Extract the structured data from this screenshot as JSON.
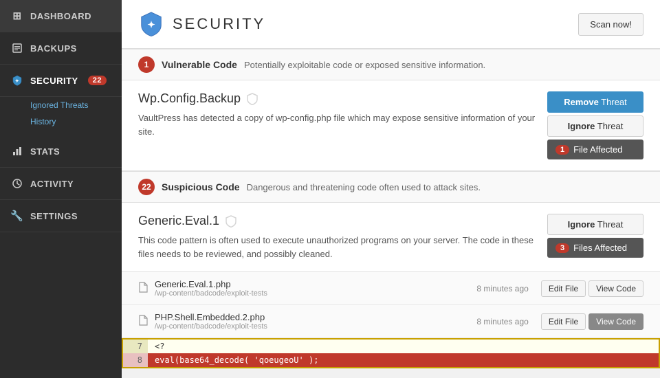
{
  "sidebar": {
    "items": [
      {
        "id": "dashboard",
        "label": "Dashboard",
        "icon": "⊞",
        "badge": null,
        "active": false
      },
      {
        "id": "backups",
        "label": "Backups",
        "icon": "🗄",
        "badge": null,
        "active": false
      },
      {
        "id": "security",
        "label": "Security",
        "icon": "✦",
        "badge": "22",
        "active": true
      },
      {
        "id": "stats",
        "label": "Stats",
        "icon": "📊",
        "badge": null,
        "active": false
      },
      {
        "id": "activity",
        "label": "Activity",
        "icon": "🔔",
        "badge": null,
        "active": false
      },
      {
        "id": "settings",
        "label": "Settings",
        "icon": "🔧",
        "badge": null,
        "active": false
      }
    ],
    "security_sub": [
      {
        "id": "ignored-threats",
        "label": "Ignored Threats"
      },
      {
        "id": "history",
        "label": "History"
      }
    ]
  },
  "header": {
    "title": "SECURITY",
    "scan_button": "Scan now!"
  },
  "threat_sections": [
    {
      "id": "vulnerable-code",
      "count": "1",
      "type": "Vulnerable Code",
      "description": "Potentially exploitable code or exposed sensitive information.",
      "threats": [
        {
          "id": "wp-config-backup",
          "name": "Wp.Config.Backup",
          "description": "VaultPress has detected a copy of wp-config.php file which may expose sensitive information of your site.",
          "actions": {
            "primary": {
              "strong": "Remove",
              "rest": " Threat"
            },
            "secondary": {
              "strong": "Ignore",
              "rest": " Threat"
            },
            "files": {
              "count": "1",
              "label": "File Affected"
            }
          }
        }
      ]
    },
    {
      "id": "suspicious-code",
      "count": "22",
      "type": "Suspicious Code",
      "description": "Dangerous and threatening code often used to attack sites.",
      "threats": [
        {
          "id": "generic-eval-1",
          "name": "Generic.Eval.1",
          "description": "This code pattern is often used to execute unauthorized programs on your server. The code in these files needs to be reviewed, and possibly cleaned.",
          "actions": {
            "secondary": {
              "strong": "Ignore",
              "rest": " Threat"
            },
            "files": {
              "count": "3",
              "label": "Files Affected"
            }
          },
          "files": [
            {
              "name": "Generic.Eval.1.php",
              "path": "/wp-content/badcode/exploit-tests",
              "time": "8 minutes ago",
              "edit_label": "Edit File",
              "view_label": "View Code"
            },
            {
              "name": "PHP.Shell.Embedded.2.php",
              "path": "/wp-content/badcode/exploit-tests",
              "time": "8 minutes ago",
              "edit_label": "Edit File",
              "view_label": "View Code",
              "view_active": true
            }
          ],
          "code_preview": {
            "lines": [
              {
                "num": "7",
                "content": "<?",
                "highlight": false
              },
              {
                "num": "8",
                "content": "eval(base64_decode( 'qoeugeoU' );",
                "highlight": true
              }
            ]
          }
        }
      ]
    }
  ]
}
